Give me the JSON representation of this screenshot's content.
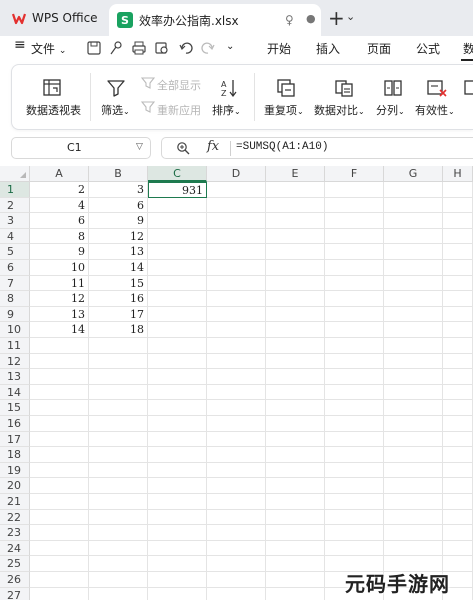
{
  "app": {
    "name": "WPS Office"
  },
  "tabs": [
    {
      "badge": "S",
      "label": "效率办公指南.xlsx"
    }
  ],
  "menu": {
    "file_label": "文件",
    "tabs": [
      {
        "label": "开始"
      },
      {
        "label": "插入"
      },
      {
        "label": "页面"
      },
      {
        "label": "公式"
      },
      {
        "label": "数"
      }
    ]
  },
  "ribbon": {
    "pivot": "数据透视表",
    "filter": "筛选",
    "show_all": "全部显示",
    "reapply": "重新应用",
    "sort": "排序",
    "duplicates": "重复项",
    "compare": "数据对比",
    "split": "分列",
    "validity": "有效性"
  },
  "formula_bar": {
    "cell_ref": "C1",
    "fx": "fx",
    "formula": "=SUMSQ(A1:A10)"
  },
  "sheet": {
    "columns": [
      "A",
      "B",
      "C",
      "D",
      "E",
      "F",
      "G",
      "H"
    ],
    "rows": [
      "1",
      "2",
      "3",
      "4",
      "5",
      "6",
      "7",
      "8",
      "9",
      "10",
      "11",
      "12",
      "13",
      "14",
      "15",
      "16",
      "17",
      "18",
      "19",
      "20",
      "21",
      "22",
      "23",
      "24",
      "25",
      "26",
      "27"
    ],
    "col_a": [
      "2",
      "4",
      "6",
      "8",
      "9",
      "10",
      "11",
      "12",
      "13",
      "14"
    ],
    "col_b": [
      "3",
      "6",
      "9",
      "12",
      "13",
      "14",
      "15",
      "16",
      "17",
      "18"
    ],
    "c1_value": "931",
    "active_cell": "C1"
  },
  "watermark": "元码手游网",
  "colors": {
    "accent": "#1e7a4f",
    "badge": "#1aa260",
    "wps_red": "#e3302f"
  }
}
